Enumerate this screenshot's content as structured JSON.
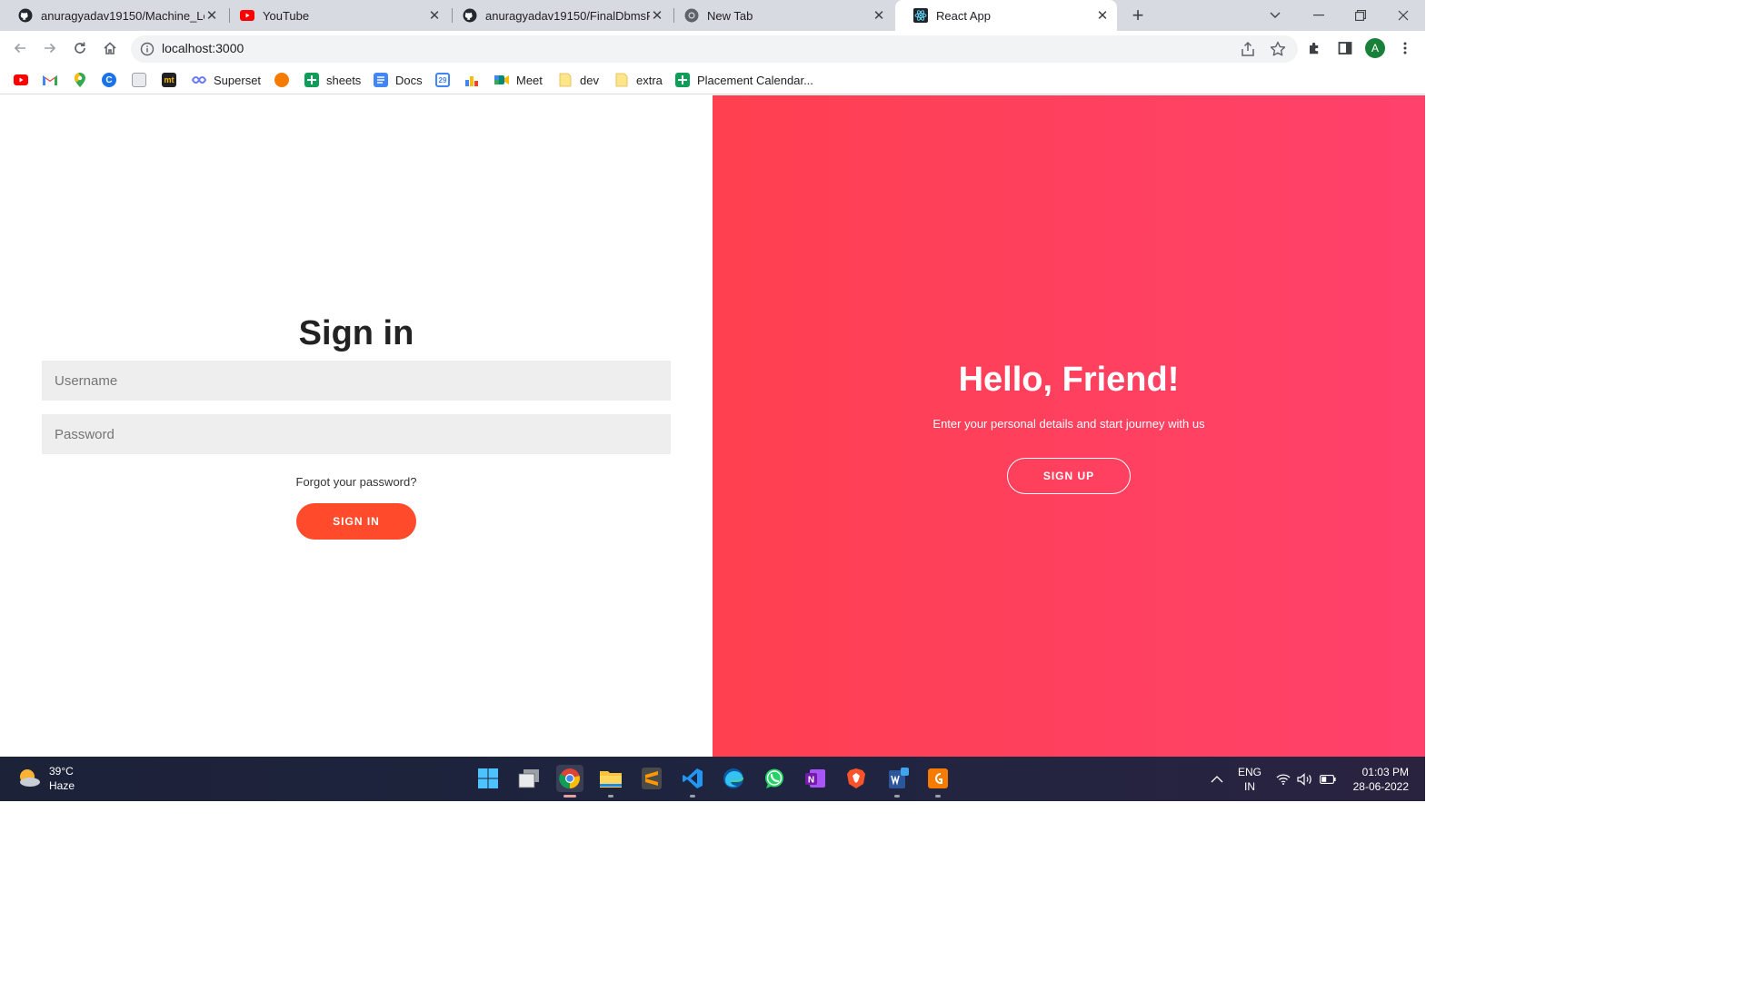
{
  "browser": {
    "tabs": [
      {
        "title": "anuragyadav19150/Machine_Lea",
        "favicon": "github-icon"
      },
      {
        "title": "YouTube",
        "favicon": "youtube-icon"
      },
      {
        "title": "anuragyadav19150/FinalDbmsPr",
        "favicon": "github-icon"
      },
      {
        "title": "New Tab",
        "favicon": "chrome-icon"
      },
      {
        "title": "React App",
        "favicon": "react-icon",
        "active": true
      }
    ],
    "url": "localhost:3000",
    "profile_initial": "A",
    "bookmarks": [
      {
        "label": "",
        "icon": "youtube-icon"
      },
      {
        "label": "",
        "icon": "gmail-icon"
      },
      {
        "label": "",
        "icon": "maps-icon"
      },
      {
        "label": "",
        "icon": "c-icon"
      },
      {
        "label": "",
        "icon": "page-icon"
      },
      {
        "label": "",
        "icon": "mt-icon"
      },
      {
        "label": "Superset",
        "icon": "superset-icon"
      },
      {
        "label": "",
        "icon": "fox-icon"
      },
      {
        "label": "sheets",
        "icon": "sheets-icon"
      },
      {
        "label": "Docs",
        "icon": "docs-icon"
      },
      {
        "label": "",
        "icon": "calendar-icon"
      },
      {
        "label": "",
        "icon": "analytics-icon"
      },
      {
        "label": "Meet",
        "icon": "meet-icon"
      },
      {
        "label": "dev",
        "icon": "folder-icon"
      },
      {
        "label": "extra",
        "icon": "folder-icon"
      },
      {
        "label": "Placement Calendar...",
        "icon": "sheets-icon"
      }
    ]
  },
  "page": {
    "signin": {
      "title": "Sign in",
      "username_placeholder": "Username",
      "password_placeholder": "Password",
      "forgot_label": "Forgot your password?",
      "button_label": "SIGN IN"
    },
    "overlay": {
      "title": "Hello, Friend!",
      "subtitle": "Enter your personal details and start journey with us",
      "button_label": "SIGN UP"
    }
  },
  "taskbar": {
    "weather_temp": "39°C",
    "weather_desc": "Haze",
    "lang_line1": "ENG",
    "lang_line2": "IN",
    "time": "01:03 PM",
    "date": "28-06-2022"
  },
  "colors": {
    "accent": "#ff4b2b",
    "overlay_gradient_start": "#ff4050",
    "overlay_gradient_end": "#ff416c"
  }
}
